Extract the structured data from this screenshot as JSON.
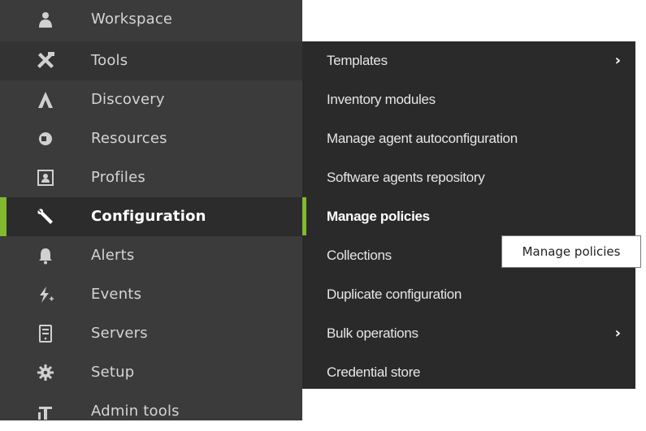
{
  "sidebar": {
    "items": [
      {
        "label": "Workspace",
        "icon": "user-icon"
      },
      {
        "label": "Tools",
        "icon": "tools-icon"
      },
      {
        "label": "Discovery",
        "icon": "discovery-icon"
      },
      {
        "label": "Resources",
        "icon": "resources-icon"
      },
      {
        "label": "Profiles",
        "icon": "profile-icon"
      },
      {
        "label": "Configuration",
        "icon": "wrench-icon",
        "active": true
      },
      {
        "label": "Alerts",
        "icon": "bell-icon"
      },
      {
        "label": "Events",
        "icon": "events-icon"
      },
      {
        "label": "Servers",
        "icon": "server-icon"
      },
      {
        "label": "Setup",
        "icon": "gear-icon"
      },
      {
        "label": "Admin tools",
        "icon": "admin-tools-icon"
      }
    ]
  },
  "submenu": {
    "items": [
      {
        "label": "Templates",
        "has_submenu": true
      },
      {
        "label": "Inventory modules"
      },
      {
        "label": "Manage agent autoconfiguration"
      },
      {
        "label": "Software agents repository"
      },
      {
        "label": "Manage policies",
        "active": true
      },
      {
        "label": "Collections"
      },
      {
        "label": "Duplicate configuration"
      },
      {
        "label": "Bulk operations",
        "has_submenu": true
      },
      {
        "label": "Credential store"
      }
    ],
    "chevron": "›"
  },
  "tooltip": {
    "text": "Manage policies"
  },
  "colors": {
    "sidebar_bg": "#3b3b3b",
    "submenu_bg": "#2a2a2a",
    "accent": "#82b92e",
    "icon": "#d0d0d0"
  }
}
